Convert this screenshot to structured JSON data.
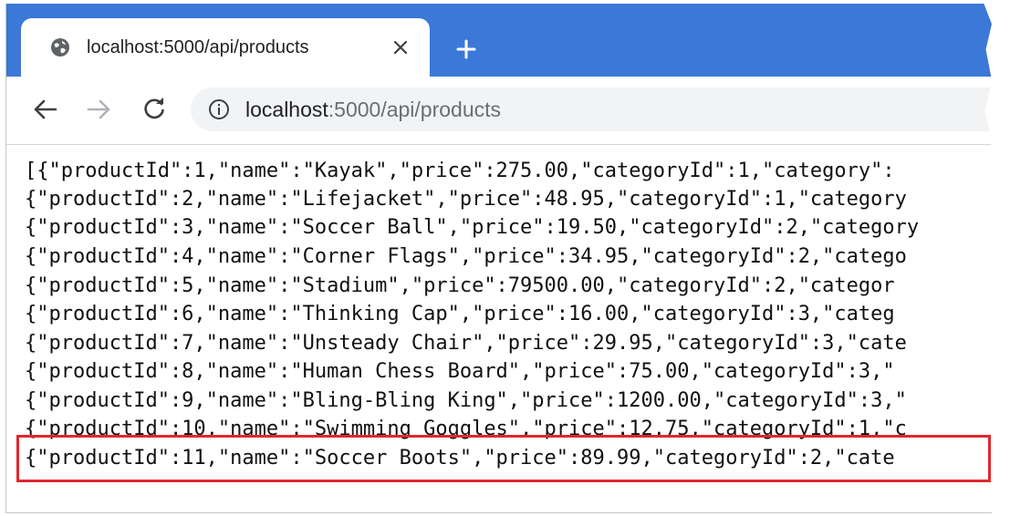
{
  "tab": {
    "title": "localhost:5000/api/products",
    "icon": "globe-icon",
    "close_icon": "close-icon"
  },
  "new_tab_icon": "plus-icon",
  "toolbar": {
    "back_icon": "arrow-left-icon",
    "forward_icon": "arrow-right-icon",
    "reload_icon": "reload-icon",
    "info_icon": "info-icon"
  },
  "address_bar": {
    "host": "localhost",
    "rest": ":5000/api/products"
  },
  "response": {
    "lines": [
      "[{\"productId\":1,\"name\":\"Kayak\",\"price\":275.00,\"categoryId\":1,\"category\":",
      "{\"productId\":2,\"name\":\"Lifejacket\",\"price\":48.95,\"categoryId\":1,\"category",
      "{\"productId\":3,\"name\":\"Soccer Ball\",\"price\":19.50,\"categoryId\":2,\"category",
      "{\"productId\":4,\"name\":\"Corner Flags\",\"price\":34.95,\"categoryId\":2,\"catego",
      "{\"productId\":5,\"name\":\"Stadium\",\"price\":79500.00,\"categoryId\":2,\"categor",
      "{\"productId\":6,\"name\":\"Thinking Cap\",\"price\":16.00,\"categoryId\":3,\"categ",
      "{\"productId\":7,\"name\":\"Unsteady Chair\",\"price\":29.95,\"categoryId\":3,\"cate",
      "{\"productId\":8,\"name\":\"Human Chess Board\",\"price\":75.00,\"categoryId\":3,\"",
      "{\"productId\":9,\"name\":\"Bling-Bling King\",\"price\":1200.00,\"categoryId\":3,\"",
      "{\"productId\":10,\"name\":\"Swimming Goggles\",\"price\":12.75,\"categoryId\":1,\"c",
      "{\"productId\":11,\"name\":\"Soccer Boots\",\"price\":89.99,\"categoryId\":2,\"cate"
    ]
  },
  "colors": {
    "tabstrip": "#3b78d8",
    "highlight": "#e0282e"
  }
}
